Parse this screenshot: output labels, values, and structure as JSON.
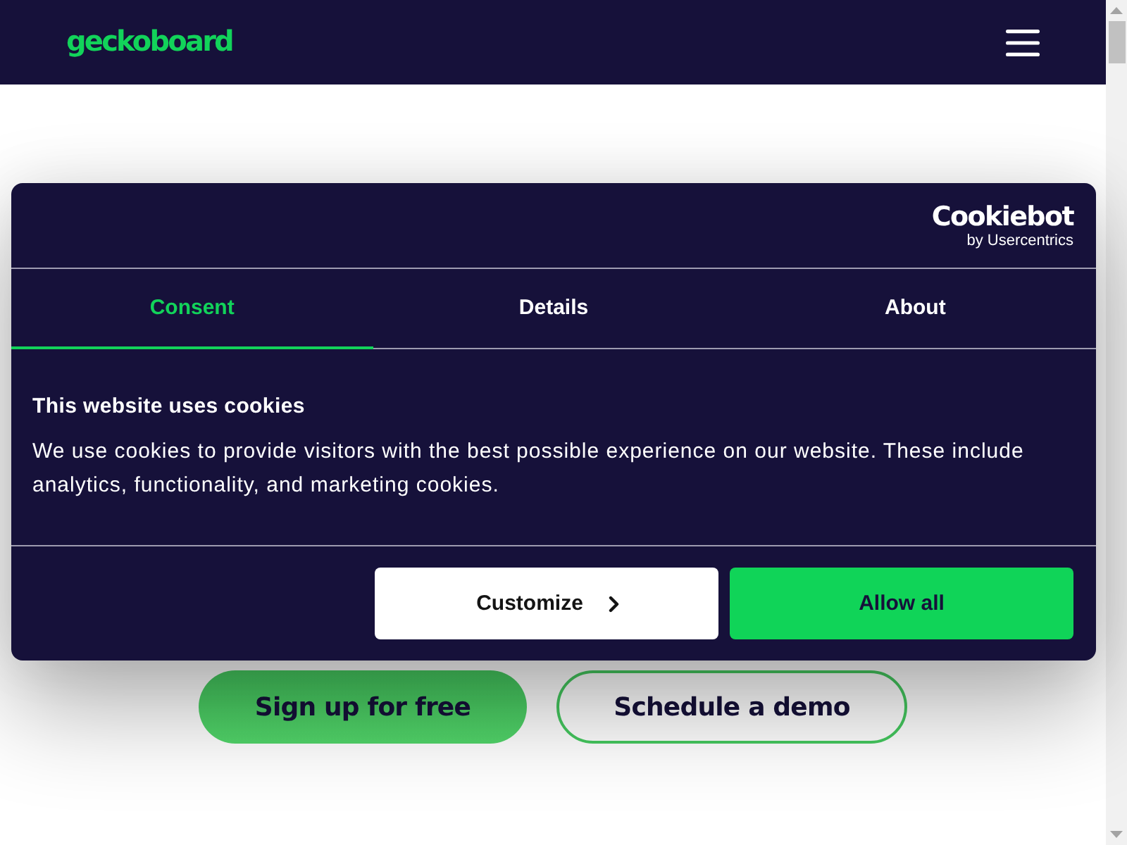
{
  "header": {
    "logo": "geckoboard"
  },
  "hero": {
    "buttons": [
      {
        "label": "Sign up for free",
        "kind": "primary"
      },
      {
        "label": "Schedule a demo",
        "kind": "outline"
      }
    ]
  },
  "cookie_dialog": {
    "brand": {
      "name": "Cookiebot",
      "byline": "by Usercentrics"
    },
    "tabs": [
      {
        "label": "Consent",
        "selected": true
      },
      {
        "label": "Details",
        "selected": false
      },
      {
        "label": "About",
        "selected": false
      }
    ],
    "title": "This website uses cookies",
    "text": "We use cookies to provide visitors with the best possible experience on our website. These include analytics, functionality, and marketing cookies.",
    "buttons": [
      {
        "label": "Customize",
        "kind": "secondary"
      },
      {
        "label": "Allow all",
        "kind": "primary"
      }
    ]
  }
}
